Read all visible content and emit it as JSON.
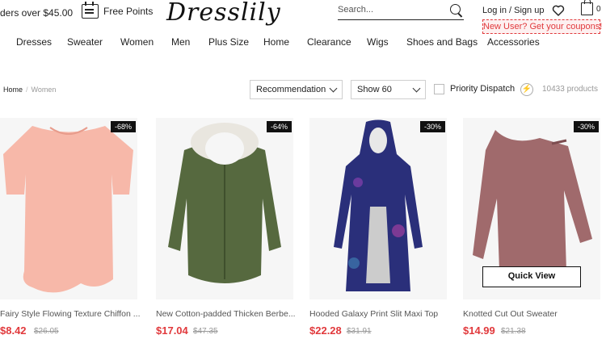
{
  "header": {
    "shipping_text": "ders over $45.00",
    "points_label": "Free Points",
    "logo_text": "Dresslily",
    "search_placeholder": "Search...",
    "login_label": "Log in / Sign up",
    "cart_count": "0",
    "coupon_label": "New User? Get your coupons!"
  },
  "nav": {
    "items": [
      "Dresses",
      "Sweater",
      "Women",
      "Men",
      "Plus Size",
      "Home",
      "Clearance",
      "Wigs",
      "Shoes and Bags",
      "Accessories"
    ]
  },
  "filters": {
    "breadcrumb": {
      "home": "Home",
      "separator": "/",
      "current": "Women"
    },
    "sort_value": "Recommendation",
    "show_value": "Show 60",
    "priority_label": "Priority Dispatch",
    "product_count": "10433 products"
  },
  "products": [
    {
      "name": "Fairy Style Flowing Texture Chiffon ...",
      "price": "$8.42",
      "old_price": "$26.05",
      "discount": "-68%",
      "icon": "pink-tunic-top"
    },
    {
      "name": "New Cotton-padded Thicken Berbe...",
      "price": "$17.04",
      "old_price": "$47.35",
      "discount": "-64%",
      "icon": "green-parka-jacket"
    },
    {
      "name": "Hooded Galaxy Print Slit Maxi Top",
      "price": "$22.28",
      "old_price": "$31.91",
      "discount": "-30%",
      "icon": "galaxy-hooded-dress"
    },
    {
      "name": "Knotted Cut Out Sweater",
      "price": "$14.99",
      "old_price": "$21.38",
      "discount": "-30%",
      "quick_view": "Quick View",
      "icon": "mauve-sweater"
    }
  ],
  "colors": {
    "accent_red": "#e1393c",
    "badge_bg": "#111111"
  }
}
